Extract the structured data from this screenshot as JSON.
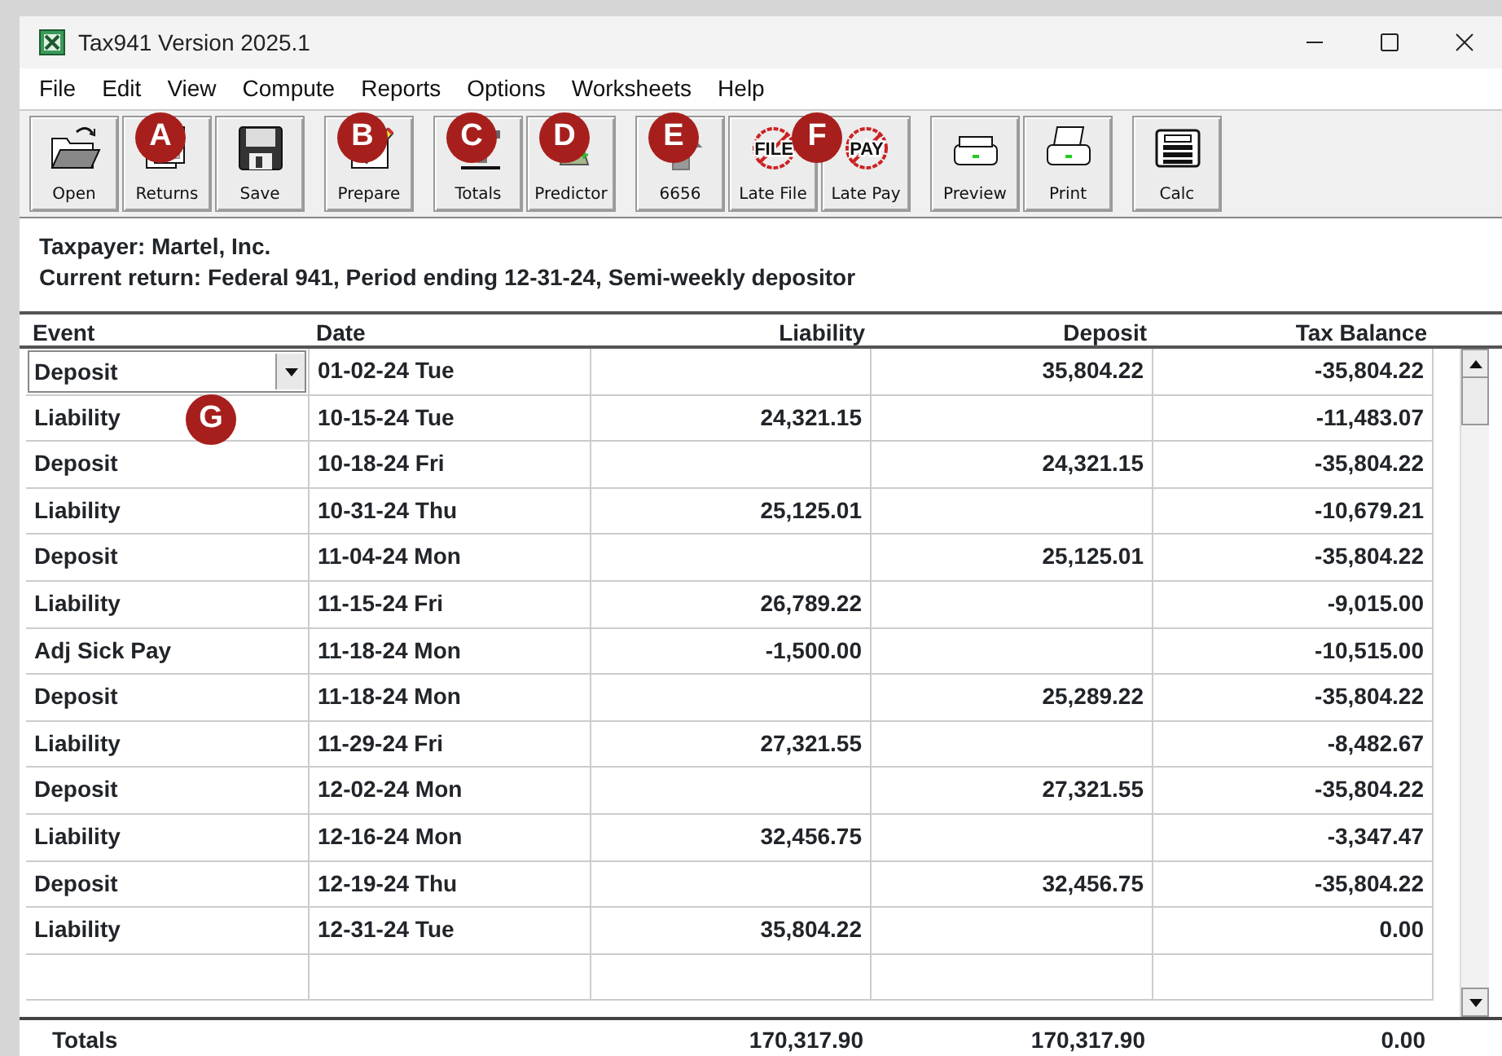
{
  "window": {
    "title": "Tax941 Version 2025.1"
  },
  "menu": [
    "File",
    "Edit",
    "View",
    "Compute",
    "Reports",
    "Options",
    "Worksheets",
    "Help"
  ],
  "toolbar": [
    [
      {
        "label": "Open"
      },
      {
        "label": "Returns",
        "callout": "A"
      },
      {
        "label": "Save"
      }
    ],
    [
      {
        "label": "Prepare",
        "callout": "B"
      }
    ],
    [
      {
        "label": "Totals",
        "callout": "C"
      },
      {
        "label": "Predictor",
        "callout": "D"
      }
    ],
    [
      {
        "label": "6656",
        "callout": "E"
      },
      {
        "label": "Late File",
        "icon_text": "FILE",
        "callout": "F"
      },
      {
        "label": "Late Pay",
        "icon_text": "PAY"
      }
    ],
    [
      {
        "label": "Preview"
      },
      {
        "label": "Print"
      }
    ],
    [
      {
        "label": "Calc"
      }
    ]
  ],
  "info": {
    "taxpayer": "Taxpayer: Martel, Inc.",
    "current_return": "Current return:  Federal 941,  Period ending 12-31-24,  Semi-weekly depositor"
  },
  "table": {
    "columns": [
      "Event",
      "Date",
      "Liability",
      "Deposit",
      "Tax Balance"
    ],
    "rows": [
      {
        "event": "Deposit",
        "date": "01-02-24 Tue",
        "liability": "",
        "deposit": "35,804.22",
        "balance": "-35,804.22",
        "selected": true
      },
      {
        "event": "Liability",
        "date": "10-15-24 Tue",
        "liability": "24,321.15",
        "deposit": "",
        "balance": "-11,483.07",
        "selected": false,
        "callout": "G"
      },
      {
        "event": "Deposit",
        "date": "10-18-24 Fri",
        "liability": "",
        "deposit": "24,321.15",
        "balance": "-35,804.22",
        "selected": false
      },
      {
        "event": "Liability",
        "date": "10-31-24 Thu",
        "liability": "25,125.01",
        "deposit": "",
        "balance": "-10,679.21",
        "selected": false
      },
      {
        "event": "Deposit",
        "date": "11-04-24 Mon",
        "liability": "",
        "deposit": "25,125.01",
        "balance": "-35,804.22",
        "selected": false
      },
      {
        "event": "Liability",
        "date": "11-15-24 Fri",
        "liability": "26,789.22",
        "deposit": "",
        "balance": "-9,015.00",
        "selected": false
      },
      {
        "event": "Adj Sick Pay",
        "date": "11-18-24 Mon",
        "liability": "-1,500.00",
        "deposit": "",
        "balance": "-10,515.00",
        "selected": false
      },
      {
        "event": "Deposit",
        "date": "11-18-24 Mon",
        "liability": "",
        "deposit": "25,289.22",
        "balance": "-35,804.22",
        "selected": false
      },
      {
        "event": "Liability",
        "date": "11-29-24 Fri",
        "liability": "27,321.55",
        "deposit": "",
        "balance": "-8,482.67",
        "selected": false
      },
      {
        "event": "Deposit",
        "date": "12-02-24 Mon",
        "liability": "",
        "deposit": "27,321.55",
        "balance": "-35,804.22",
        "selected": false
      },
      {
        "event": "Liability",
        "date": "12-16-24 Mon",
        "liability": "32,456.75",
        "deposit": "",
        "balance": "-3,347.47",
        "selected": false
      },
      {
        "event": "Deposit",
        "date": "12-19-24 Thu",
        "liability": "",
        "deposit": "32,456.75",
        "balance": "-35,804.22",
        "selected": false
      },
      {
        "event": "Liability",
        "date": "12-31-24 Tue",
        "liability": "35,804.22",
        "deposit": "",
        "balance": "0.00",
        "selected": false
      }
    ],
    "totals": {
      "label": "Totals",
      "liability": "170,317.90",
      "deposit": "170,317.90",
      "balance": "0.00"
    }
  }
}
